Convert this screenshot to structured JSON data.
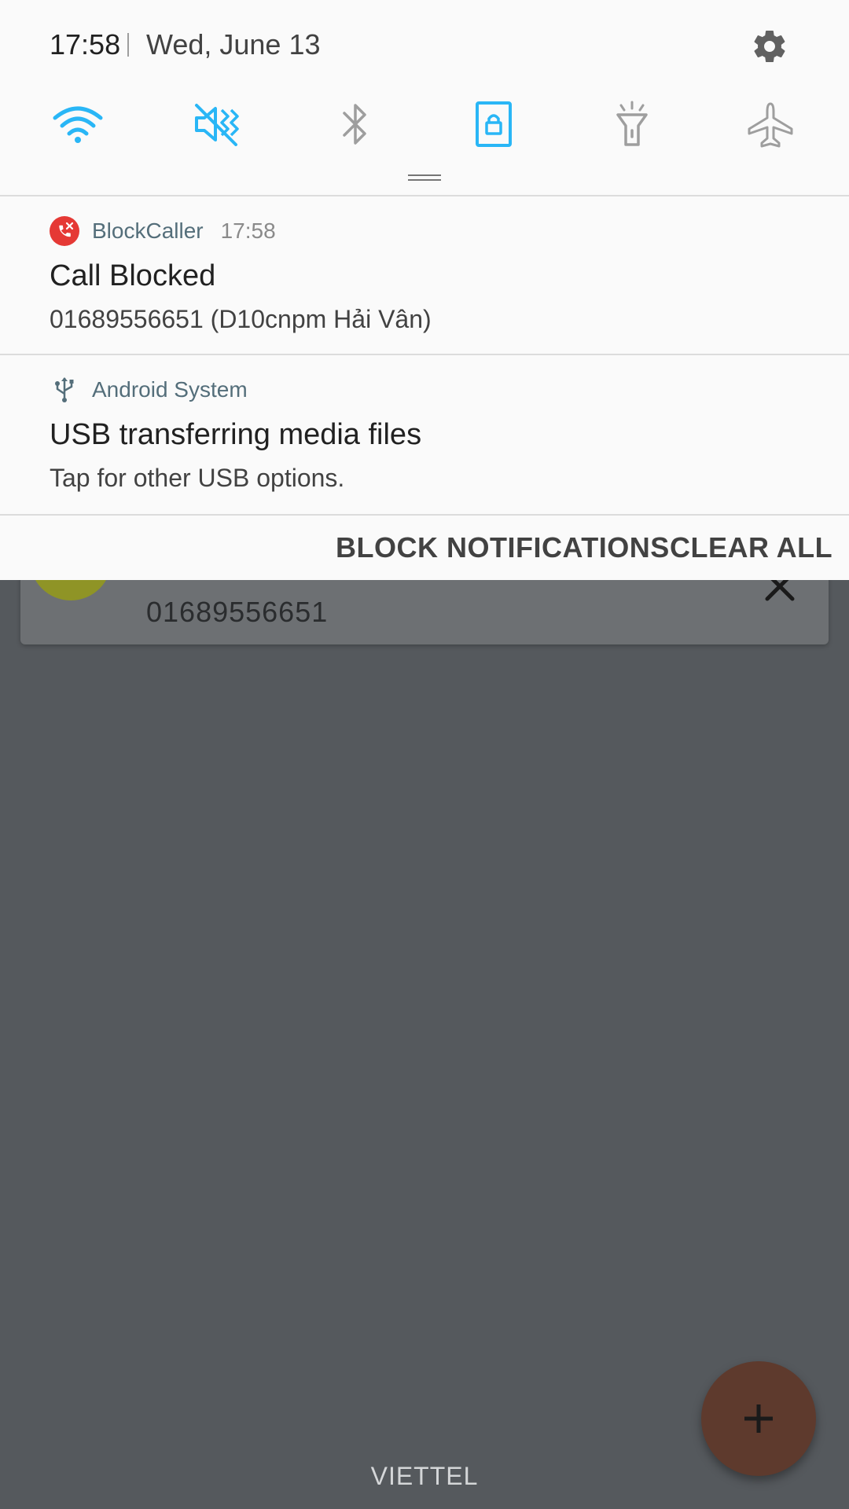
{
  "status": {
    "time": "17:58",
    "date": "Wed, June 13"
  },
  "quick_settings": [
    {
      "icon": "wifi-icon",
      "active": true
    },
    {
      "icon": "sound-muted-vibrate-icon",
      "active": true
    },
    {
      "icon": "bluetooth-icon",
      "active": false
    },
    {
      "icon": "screen-rotation-lock-icon",
      "active": true
    },
    {
      "icon": "flashlight-icon",
      "active": false
    },
    {
      "icon": "airplane-mode-icon",
      "active": false
    }
  ],
  "notifications": [
    {
      "app": "BlockCaller",
      "time": "17:58",
      "title": "Call Blocked",
      "text": "01689556651 (D10cnpm Hải Vân)"
    },
    {
      "app": "Android System",
      "title": "USB transferring media files",
      "text": "Tap for other USB options."
    }
  ],
  "actions": {
    "block": "BLOCK NOTIFICATIONS",
    "clear": "CLEAR ALL"
  },
  "background_app": {
    "number": "01689556651",
    "carrier": "VIETTEL"
  },
  "colors": {
    "accent": "#29b6f6",
    "inactive_icon": "#9e9e9e",
    "blockcaller_red": "#e53935",
    "scrim": "#55595d",
    "fab": "#5e3a2d"
  }
}
